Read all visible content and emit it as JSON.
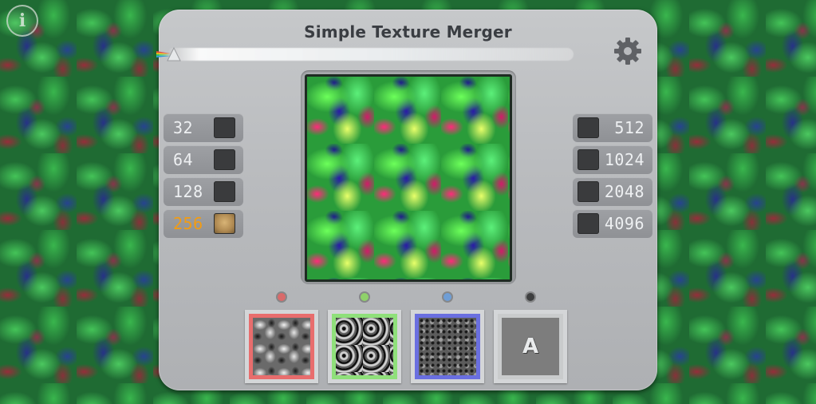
{
  "app": {
    "title": "Simple Texture Merger"
  },
  "info_button": {
    "glyph": "i",
    "icon": "info-icon"
  },
  "settings_button": {
    "icon": "gear-icon"
  },
  "sizes_left": [
    {
      "label": "32",
      "selected": false
    },
    {
      "label": "64",
      "selected": false
    },
    {
      "label": "128",
      "selected": false
    },
    {
      "label": "256",
      "selected": true
    }
  ],
  "sizes_right": [
    {
      "label": "512",
      "selected": false
    },
    {
      "label": "1024",
      "selected": false
    },
    {
      "label": "2048",
      "selected": false
    },
    {
      "label": "4096",
      "selected": false
    }
  ],
  "channels": [
    {
      "name": "red",
      "color": "#e86d6d",
      "dot": "#d96a6a"
    },
    {
      "name": "green",
      "color": "#8fe07a",
      "dot": "#8fd16a"
    },
    {
      "name": "blue",
      "color": "#6a6fe0",
      "dot": "#6f9ed6"
    },
    {
      "name": "alpha",
      "color": "#c9cbcc",
      "dot": "#3e3f40",
      "label": "A"
    }
  ],
  "colors": {
    "selected_size_text": "#f39c12",
    "panel": "#bfc1c4"
  }
}
